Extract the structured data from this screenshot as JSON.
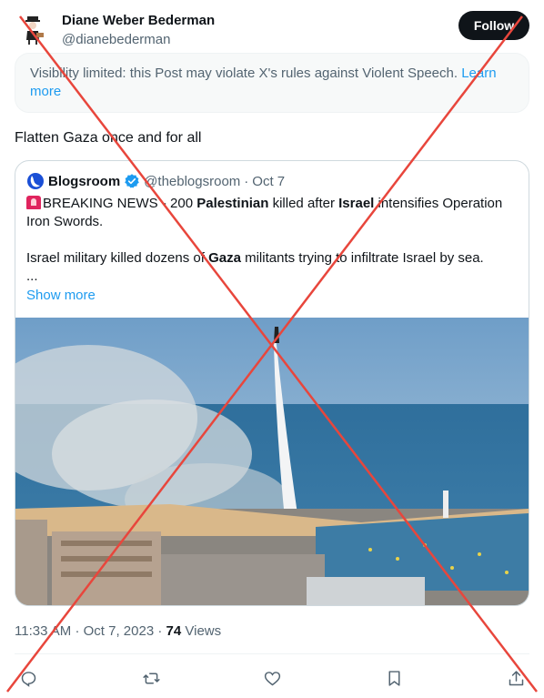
{
  "author": {
    "name": "Diane Weber Bederman",
    "handle": "@dianebederman",
    "follow_label": "Follow"
  },
  "notice": {
    "text": "Visibility limited: this Post may violate X's rules against Violent Speech.",
    "link": "Learn more"
  },
  "tweet": {
    "text": "Flatten Gaza once and for all"
  },
  "quote": {
    "name": "Blogsroom",
    "handle": "@theblogsroom",
    "separator": "·",
    "date": "Oct 7",
    "line1_a": "BREAKING NEWS - 200 ",
    "line1_b": "Palestinian",
    "line1_c": " killed after ",
    "line1_d": "Israel",
    "line1_e": " intensifies Operation Iron Swords.",
    "line2_a": "Israel military killed dozens of ",
    "line2_b": "Gaza",
    "line2_c": " militants trying to infiltrate Israel by sea.",
    "ellipsis": "...",
    "show_more": "Show more"
  },
  "meta": {
    "time": "11:33 AM",
    "sep1": "·",
    "date": "Oct 7, 2023",
    "sep2": "·",
    "views_count": "74",
    "views_label": "Views"
  },
  "actions": {
    "icons": [
      "reply-icon",
      "repost-icon",
      "like-icon",
      "bookmark-icon",
      "share-icon"
    ]
  },
  "colors": {
    "accent": "#1d9bf0",
    "text": "#0f1419",
    "muted": "#536471",
    "overlay_cross": "#e8463c"
  }
}
